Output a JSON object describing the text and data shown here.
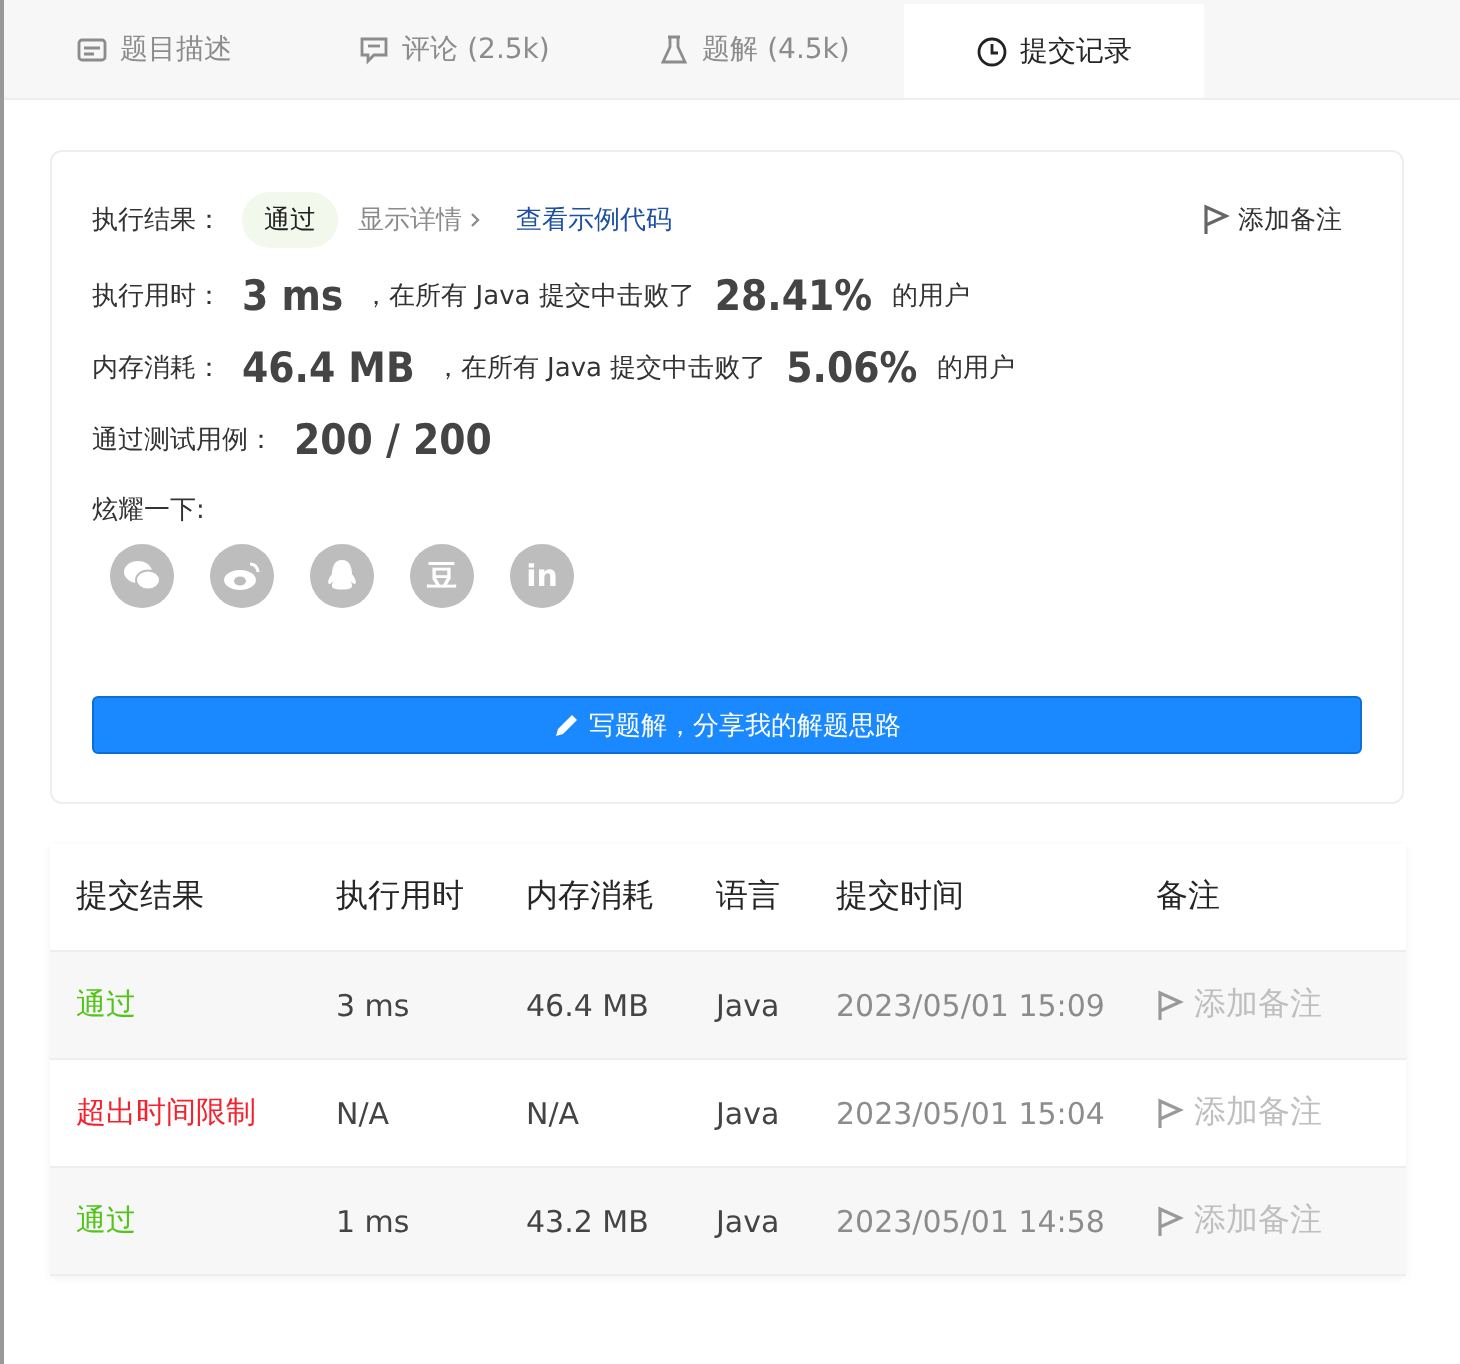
{
  "tabs": [
    {
      "label": "题目描述",
      "kind": "description",
      "selected": false
    },
    {
      "label": "评论 (2.5k)",
      "kind": "comment",
      "selected": false
    },
    {
      "label": "题解 (4.5k)",
      "kind": "flask",
      "selected": false
    },
    {
      "label": "提交记录",
      "kind": "clock",
      "selected": true
    }
  ],
  "result": {
    "label": "执行结果：",
    "status": "通过",
    "details": "显示详情",
    "sample_code": "查看示例代码",
    "add_note": "添加备注"
  },
  "stats": [
    {
      "label": "执行用时：",
      "value": "3 ms",
      "middle": "，在所有 Java 提交中击败了",
      "percent": "28.41%",
      "suffix": "的用户"
    },
    {
      "label": "内存消耗：",
      "value": "46.4 MB",
      "middle": "，在所有 Java 提交中击败了",
      "percent": "5.06%",
      "suffix": "的用户"
    }
  ],
  "tests": {
    "label": "通过测试用例：",
    "value": "200 / 200"
  },
  "share": {
    "label": "炫耀一下:",
    "items": [
      {
        "kind": "chat"
      },
      {
        "kind": "eye"
      },
      {
        "kind": "penguin"
      },
      {
        "kind": "glyph",
        "text": "豆"
      },
      {
        "kind": "glyph",
        "text": "in"
      }
    ]
  },
  "write_button": "写题解，分享我的解题思路",
  "table": {
    "columns": [
      "提交结果",
      "执行用时",
      "内存消耗",
      "语言",
      "提交时间",
      "备注"
    ],
    "rows": [
      {
        "status": "通过",
        "color": "#52c41a",
        "time": "3 ms",
        "memory": "46.4 MB",
        "language": "Java",
        "submitted": "2023/05/01 15:09",
        "note": "添加备注"
      },
      {
        "status": "超出时间限制",
        "color": "#f5222d",
        "time": "N/A",
        "memory": "N/A",
        "language": "Java",
        "submitted": "2023/05/01 15:04",
        "note": "添加备注"
      },
      {
        "status": "通过",
        "color": "#52c41a",
        "time": "1 ms",
        "memory": "43.2 MB",
        "language": "Java",
        "submitted": "2023/05/01 14:58",
        "note": "添加备注"
      }
    ]
  }
}
